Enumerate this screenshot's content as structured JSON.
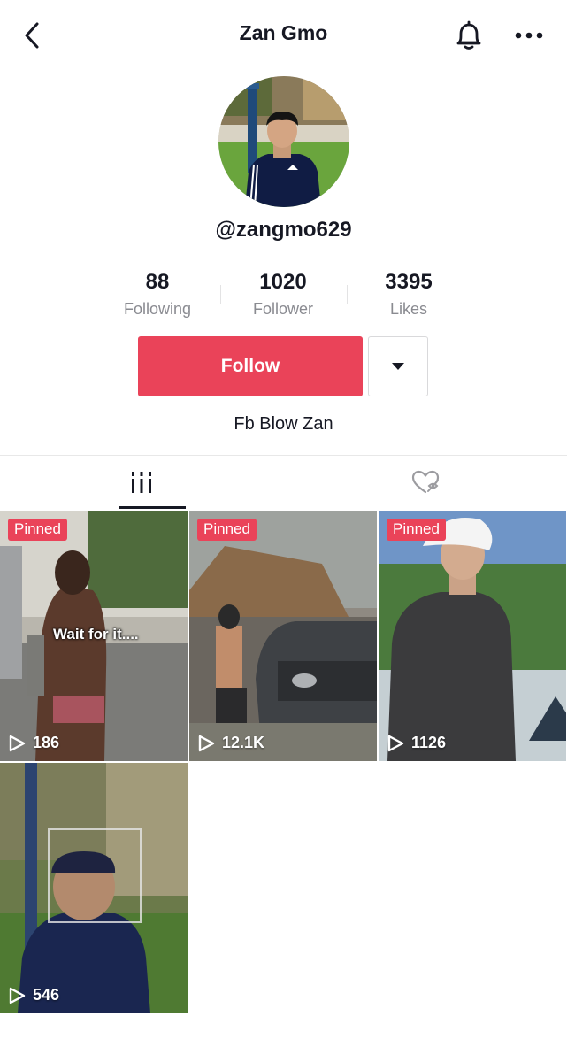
{
  "header": {
    "title": "Zan Gmo",
    "icons": {
      "back": "chevron-left-icon",
      "bell": "bell-icon",
      "more": "more-horizontal-icon"
    }
  },
  "profile": {
    "username": "@zangmo629",
    "bio": "Fb Blow Zan",
    "stats": [
      {
        "value": "88",
        "label": "Following"
      },
      {
        "value": "1020",
        "label": "Follower"
      },
      {
        "value": "3395",
        "label": "Likes"
      }
    ],
    "follow_label": "Follow",
    "accent_color": "#ea4359"
  },
  "tabs": [
    {
      "name": "videos",
      "icon": "grid-bars-icon",
      "active": true
    },
    {
      "name": "liked",
      "icon": "heart-hidden-icon",
      "active": false
    }
  ],
  "videos": [
    {
      "pinned_label": "Pinned",
      "views": "186",
      "overlay_text": "Wait for it...."
    },
    {
      "pinned_label": "Pinned",
      "views": "12.1K",
      "overlay_text": ""
    },
    {
      "pinned_label": "Pinned",
      "views": "1126",
      "overlay_text": ""
    },
    {
      "pinned_label": "",
      "views": "546",
      "overlay_text": ""
    }
  ]
}
